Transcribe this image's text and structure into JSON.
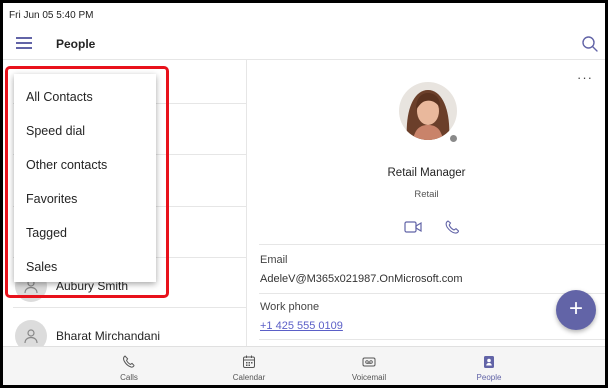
{
  "status": {
    "datetime": "Fri Jun 05  5:40 PM"
  },
  "appbar": {
    "title": "People"
  },
  "dropdown": {
    "items": [
      "All Contacts",
      "Speed dial",
      "Other contacts",
      "Favorites",
      "Tagged",
      "Sales"
    ]
  },
  "contacts": [
    {
      "name": "Aubury Smith"
    },
    {
      "name": "Bharat Mirchandani"
    }
  ],
  "detail": {
    "job_title": "Retail Manager",
    "department": "Retail",
    "email_label": "Email",
    "email_value": "AdeleV@M365x021987.OnMicrosoft.com",
    "phone_label": "Work phone",
    "phone_value": "+1 425 555 0109",
    "more_label": "···",
    "fab_label": "+"
  },
  "nav": {
    "tabs": [
      {
        "label": "Calls",
        "icon": "phone-icon"
      },
      {
        "label": "Calendar",
        "icon": "calendar-icon"
      },
      {
        "label": "Voicemail",
        "icon": "voicemail-icon"
      },
      {
        "label": "People",
        "icon": "people-icon",
        "active": true
      }
    ]
  },
  "colors": {
    "accent": "#6264a7",
    "highlight": "#e8111b",
    "presence": "#8a8a8a"
  }
}
